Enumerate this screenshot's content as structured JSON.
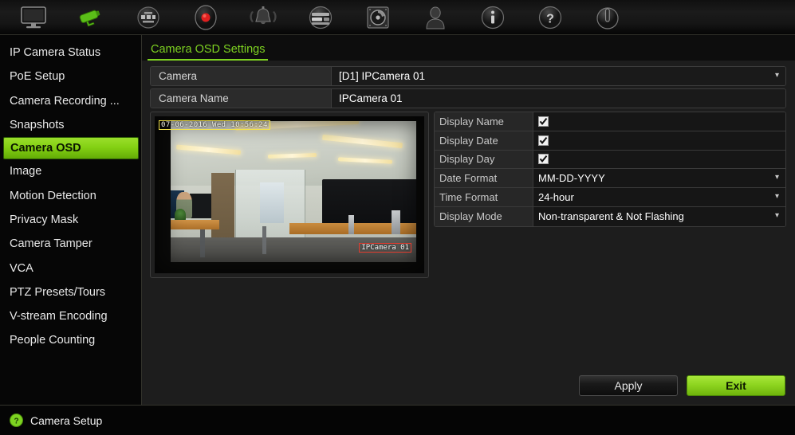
{
  "toolbar": {
    "items": [
      {
        "name": "monitor-icon",
        "label": "Display"
      },
      {
        "name": "camera-icon",
        "label": "Camera"
      },
      {
        "name": "network-icon",
        "label": "Network"
      },
      {
        "name": "record-icon",
        "label": "Recording"
      },
      {
        "name": "alarm-icon",
        "label": "Alarm"
      },
      {
        "name": "device-icon",
        "label": "Device Management"
      },
      {
        "name": "hdd-icon",
        "label": "HDD"
      },
      {
        "name": "user-icon",
        "label": "User"
      },
      {
        "name": "info-icon",
        "label": "System Information"
      },
      {
        "name": "help-icon",
        "label": "Help"
      },
      {
        "name": "power-icon",
        "label": "Shutdown"
      }
    ]
  },
  "sidebar": {
    "items": [
      {
        "label": "IP Camera Status",
        "active": false
      },
      {
        "label": "PoE Setup",
        "active": false
      },
      {
        "label": "Camera Recording ...",
        "active": false
      },
      {
        "label": "Snapshots",
        "active": false
      },
      {
        "label": "Camera OSD",
        "active": true
      },
      {
        "label": "Image",
        "active": false
      },
      {
        "label": "Motion Detection",
        "active": false
      },
      {
        "label": "Privacy Mask",
        "active": false
      },
      {
        "label": "Camera Tamper",
        "active": false
      },
      {
        "label": "VCA",
        "active": false
      },
      {
        "label": "PTZ Presets/Tours",
        "active": false
      },
      {
        "label": "V-stream Encoding",
        "active": false
      },
      {
        "label": "People Counting",
        "active": false
      }
    ]
  },
  "main": {
    "tab_label": "Camera OSD Settings",
    "fields": [
      {
        "label": "Camera",
        "value": "[D1] IPCamera 01",
        "type": "dropdown"
      },
      {
        "label": "Camera Name",
        "value": "IPCamera 01",
        "type": "text"
      }
    ],
    "preview": {
      "osd_timestamp": "07-06-2016 Wed 10:56:24",
      "osd_camera_name": "IPCamera 01"
    },
    "settings": [
      {
        "label": "Display Name",
        "type": "checkbox",
        "checked": true
      },
      {
        "label": "Display Date",
        "type": "checkbox",
        "checked": true
      },
      {
        "label": "Display Day",
        "type": "checkbox",
        "checked": true
      },
      {
        "label": "Date Format",
        "type": "dropdown",
        "value": "MM-DD-YYYY"
      },
      {
        "label": "Time Format",
        "type": "dropdown",
        "value": "24-hour"
      },
      {
        "label": "Display Mode",
        "type": "dropdown",
        "value": "Non-transparent & Not Flashing"
      }
    ],
    "buttons": {
      "apply": "Apply",
      "exit": "Exit"
    }
  },
  "statusbar": {
    "icon": "help-circle-icon",
    "text": "Camera Setup"
  },
  "colors": {
    "accent_green": "#8ed520",
    "tab_green": "#7ed321",
    "panel_bg": "#1d1d1d",
    "sidebar_bg": "#060606",
    "osd_time_box": "#f2e24a",
    "osd_name_box": "#e03b2e"
  }
}
